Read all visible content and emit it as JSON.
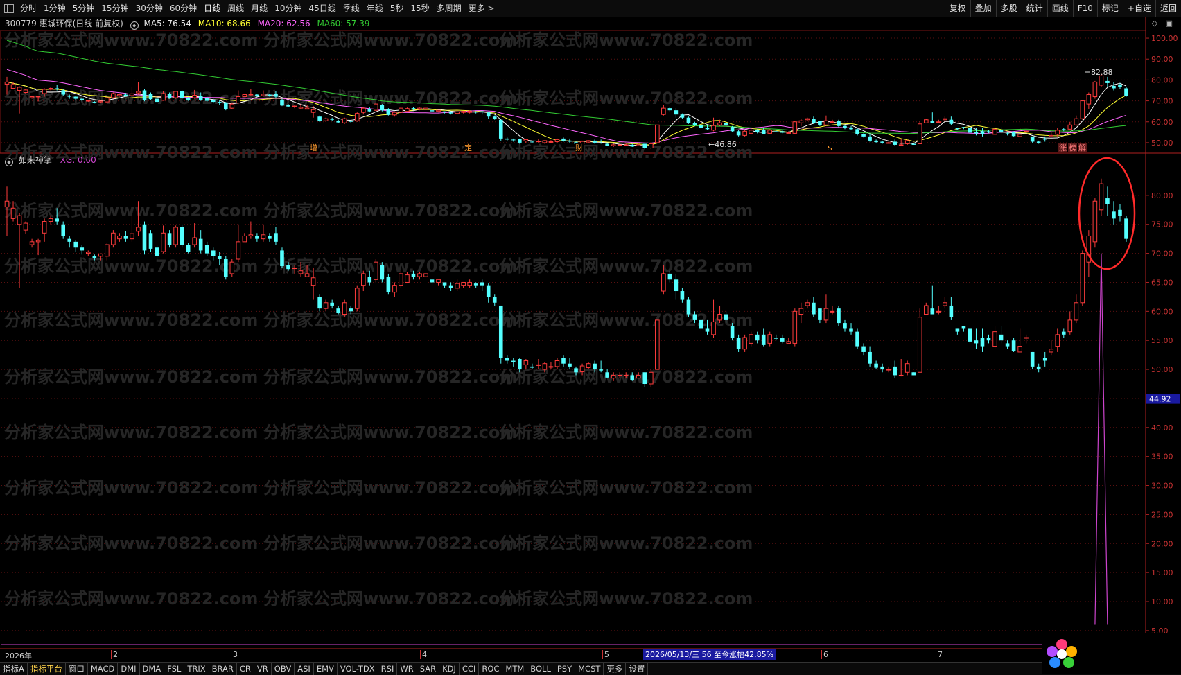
{
  "toolbar": {
    "periods": [
      "分时",
      "1分钟",
      "5分钟",
      "15分钟",
      "30分钟",
      "60分钟",
      "日线",
      "周线",
      "月线",
      "10分钟",
      "45日线",
      "季线",
      "年线",
      "5秒",
      "15秒",
      "多周期",
      "更多 >"
    ],
    "active_period": "日线",
    "right_buttons": [
      "复权",
      "叠加",
      "多股",
      "统计",
      "画线",
      "F10",
      "标记",
      "+自选",
      "返回"
    ]
  },
  "stock": {
    "code_name": "300779 惠城环保(日线 前复权)",
    "ma5": "MA5: 76.54",
    "ma10": "MA10: 68.66",
    "ma20": "MA20: 62.56",
    "ma60": "MA60: 57.39"
  },
  "colors": {
    "up": "#ff3c3c",
    "down": "#54ffff",
    "ma5": "#ffffff",
    "ma10": "#ffff33",
    "ma20": "#ff66ff",
    "ma60": "#33cc33",
    "grid": "#5a1010",
    "axis_text": "#c83232",
    "indicator_line": "#cc44cc",
    "highlight_circle": "#ff2a2a"
  },
  "indicator": {
    "name": "如来神掌",
    "xg": "XG: 0.00"
  },
  "main_axis": [
    "100.00",
    "90.00",
    "80.00",
    "70.00",
    "60.00",
    "50.00"
  ],
  "ind_axis": [
    "80.00",
    "75.00",
    "70.00",
    "65.00",
    "60.00",
    "55.00",
    "50.00",
    "45.00",
    "40.00",
    "35.00",
    "30.00",
    "25.00",
    "20.00",
    "15.00",
    "10.00",
    "5.00"
  ],
  "price_tag": "44.92",
  "annotations": {
    "high": "82.88",
    "low": "46.86",
    "events": [
      "增",
      "定",
      "财",
      "$",
      "涨",
      "榜",
      "解"
    ]
  },
  "watermark": "分析家公式网www.70822.com",
  "date_axis": {
    "year_label": "2026年",
    "months": [
      "2",
      "3",
      "4",
      "5",
      "6",
      "7"
    ],
    "status": "2026/05/13/三  56 至今涨幅42.85%"
  },
  "chart_data": {
    "type": "candlestick",
    "candles": [
      [
        78,
        79,
        73,
        81.5
      ],
      [
        76,
        77.8,
        75.5,
        79
      ],
      [
        75,
        76.5,
        64,
        77
      ],
      [
        74,
        75.2,
        73.4,
        75.5
      ],
      [
        71.5,
        72,
        71,
        72.5
      ],
      [
        72,
        72.2,
        69.7,
        72.5
      ],
      [
        73.5,
        75.5,
        72,
        76
      ],
      [
        75.5,
        76,
        75,
        76.5
      ],
      [
        76,
        75.5,
        75,
        77.8
      ],
      [
        75,
        73,
        72.5,
        75.5
      ],
      [
        72.5,
        72,
        71,
        73
      ],
      [
        72,
        71,
        70.2,
        72.3
      ],
      [
        71,
        70.5,
        69.8,
        71.5
      ],
      [
        70,
        70.2,
        69.5,
        70.5
      ],
      [
        69.5,
        69.2,
        68.8,
        69.8
      ],
      [
        69.5,
        69.9,
        68.8,
        70
      ],
      [
        69.5,
        71.5,
        68.8,
        71.8
      ],
      [
        71.5,
        73.5,
        71,
        74
      ],
      [
        72.5,
        73,
        72,
        73.5
      ],
      [
        73,
        72.5,
        72,
        73.8
      ],
      [
        72.5,
        73.4,
        72,
        76.5
      ],
      [
        73.8,
        74.5,
        73,
        79
      ],
      [
        75,
        70.5,
        69.8,
        75.5
      ],
      [
        73.5,
        70.8,
        70.2,
        74
      ],
      [
        71,
        69.5,
        68.8,
        71.5
      ],
      [
        70.3,
        73.5,
        70,
        74.8
      ],
      [
        73.5,
        71.5,
        71,
        74
      ],
      [
        71.5,
        74.5,
        71,
        74.8
      ],
      [
        74.5,
        71.5,
        71,
        75
      ],
      [
        71.5,
        70.2,
        70,
        71.8
      ],
      [
        71.5,
        72.7,
        71,
        75.2
      ],
      [
        72.5,
        70.5,
        70,
        74
      ],
      [
        71.5,
        70,
        69.5,
        72
      ],
      [
        70.5,
        69.5,
        68.8,
        71
      ],
      [
        69.5,
        69,
        68,
        70.3
      ],
      [
        69,
        66,
        65.5,
        69.5
      ],
      [
        66.5,
        68.5,
        66,
        69
      ],
      [
        69,
        72,
        68.5,
        75
      ],
      [
        72,
        73,
        72.5,
        73.5
      ],
      [
        73,
        73.2,
        72.5,
        75.5
      ],
      [
        73,
        72.5,
        72,
        73.5
      ],
      [
        72.5,
        73.2,
        72,
        75
      ],
      [
        73,
        72.5,
        72,
        73.5
      ],
      [
        73.5,
        72,
        71.5,
        74.5
      ],
      [
        70.5,
        67.8,
        67.5,
        71
      ],
      [
        68,
        67.3,
        67,
        68.5
      ],
      [
        67.5,
        67.5,
        66.5,
        68
      ],
      [
        66.5,
        67,
        66,
        68.5
      ],
      [
        66,
        66.5,
        66,
        68
      ],
      [
        64.5,
        65.8,
        62,
        67.5
      ],
      [
        62.5,
        60.5,
        60,
        63
      ],
      [
        60.5,
        61.5,
        60,
        62
      ],
      [
        61.5,
        61,
        60.5,
        62
      ],
      [
        60.5,
        59.7,
        59.5,
        61
      ],
      [
        59.5,
        61.5,
        59,
        62
      ],
      [
        60.5,
        60,
        59.5,
        61
      ],
      [
        60.5,
        64,
        60,
        64.5
      ],
      [
        64.5,
        66.5,
        63.5,
        67
      ],
      [
        66,
        65,
        64.5,
        67
      ],
      [
        65.5,
        68.5,
        65,
        69
      ],
      [
        68,
        65.5,
        65,
        68.5
      ],
      [
        66,
        63.3,
        63,
        66.5
      ],
      [
        63.3,
        64.5,
        62.5,
        65
      ],
      [
        64.5,
        66.5,
        64,
        67
      ],
      [
        65,
        66.3,
        65.5,
        66.8
      ],
      [
        66.5,
        66,
        65.5,
        67
      ],
      [
        66,
        66.5,
        65.5,
        66.8
      ],
      [
        66,
        66.5,
        65.5,
        67
      ],
      [
        65.5,
        65,
        64.5,
        65.5
      ],
      [
        65,
        65.5,
        64.5,
        65.5
      ],
      [
        65,
        64.5,
        64,
        65
      ],
      [
        64.5,
        64,
        63.5,
        65
      ],
      [
        64,
        64.8,
        63.5,
        65.5
      ],
      [
        64.5,
        65,
        64,
        65
      ],
      [
        64.5,
        65,
        64,
        65.5
      ],
      [
        64.8,
        64.5,
        64,
        65
      ],
      [
        65,
        64.5,
        63.5,
        65.5
      ],
      [
        64.5,
        62.5,
        61.5,
        64.8
      ],
      [
        62.5,
        61.5,
        61,
        63
      ],
      [
        61,
        52,
        51,
        61
      ],
      [
        52,
        51.5,
        51,
        52.5
      ],
      [
        51.5,
        51.3,
        50.5,
        52
      ],
      [
        51.8,
        50,
        49.5,
        52
      ],
      [
        50.8,
        51.5,
        50,
        51.8
      ],
      [
        50.5,
        50.3,
        50,
        51
      ],
      [
        50.8,
        50.8,
        50,
        51.8
      ],
      [
        50,
        51,
        49.5,
        51.2
      ],
      [
        50.5,
        50.5,
        50,
        51.2
      ],
      [
        50.5,
        51.5,
        50,
        52
      ],
      [
        52,
        51,
        50.5,
        52.5
      ],
      [
        51,
        50.5,
        50,
        52
      ],
      [
        50.2,
        49.5,
        49,
        50.5
      ],
      [
        49.6,
        50.6,
        49,
        51
      ],
      [
        50.3,
        51,
        50,
        51.2
      ],
      [
        51,
        50,
        49.5,
        51.5
      ],
      [
        50,
        49.8,
        49.5,
        51.5
      ],
      [
        49.5,
        48.6,
        48.5,
        50
      ],
      [
        48.5,
        49,
        48,
        49.5
      ],
      [
        49,
        49,
        48.5,
        49.5
      ],
      [
        49,
        49,
        48.5,
        49.5
      ],
      [
        49,
        48.2,
        48,
        49.5
      ],
      [
        48.5,
        49,
        48.5,
        49.5
      ],
      [
        49.5,
        47.5,
        47,
        49.5
      ],
      [
        47.5,
        49.5,
        47,
        50
      ],
      [
        50,
        58.5,
        50,
        58.5
      ],
      [
        63.5,
        66.5,
        63,
        68
      ],
      [
        66.5,
        65.5,
        65,
        67
      ],
      [
        65.5,
        63.5,
        62,
        66.5
      ],
      [
        63.5,
        62,
        61.5,
        64
      ],
      [
        62,
        59.5,
        59,
        62.5
      ],
      [
        59.5,
        58.5,
        58,
        60
      ],
      [
        58.5,
        57,
        56.5,
        59
      ],
      [
        57,
        56.5,
        56,
        58.5
      ],
      [
        56,
        58.2,
        55.5,
        62
      ],
      [
        58.5,
        59.5,
        58,
        61
      ],
      [
        59.5,
        58.5,
        58,
        60
      ],
      [
        57.5,
        55.5,
        55,
        58
      ],
      [
        55.5,
        53.5,
        53,
        56
      ],
      [
        53.5,
        55.5,
        53,
        56
      ],
      [
        54.5,
        56,
        54,
        56.5
      ],
      [
        56,
        55,
        54.5,
        56.5
      ],
      [
        56,
        54.2,
        54,
        57
      ],
      [
        54.5,
        56,
        54,
        56.5
      ],
      [
        55.5,
        55.3,
        55,
        56
      ],
      [
        55.5,
        54.8,
        54.5,
        56
      ],
      [
        54.5,
        54.8,
        54.5,
        55.5
      ],
      [
        54.5,
        60,
        54,
        60.5
      ],
      [
        59.5,
        60.5,
        58,
        61.5
      ],
      [
        61,
        61.5,
        60.5,
        62
      ],
      [
        61.5,
        59.5,
        59,
        62.5
      ],
      [
        60.5,
        58.5,
        58,
        60
      ],
      [
        58.5,
        60.5,
        58,
        63
      ],
      [
        60,
        60,
        59.5,
        61
      ],
      [
        60.5,
        58,
        57.5,
        61
      ],
      [
        58,
        57,
        56.5,
        58.5
      ],
      [
        57,
        56.5,
        56,
        58
      ],
      [
        56.5,
        54,
        53.5,
        57
      ],
      [
        54,
        53,
        52.5,
        54.5
      ],
      [
        53,
        51,
        50.5,
        54
      ],
      [
        51,
        50.3,
        50,
        51.5
      ],
      [
        50.5,
        50,
        49.5,
        51
      ],
      [
        50,
        50,
        49.5,
        50.5
      ],
      [
        50.5,
        49,
        48.5,
        51.5
      ],
      [
        49,
        49,
        48.8,
        51.8
      ],
      [
        49.5,
        51,
        49,
        51.5
      ],
      [
        49.5,
        49,
        49,
        49.5
      ],
      [
        49.5,
        59,
        49.5,
        60.5
      ],
      [
        59.5,
        61,
        60.5,
        61.5
      ],
      [
        60.5,
        59.5,
        59.5,
        64.5
      ],
      [
        60,
        60,
        59.5,
        61
      ],
      [
        61,
        61.5,
        60.5,
        62.5
      ],
      [
        61,
        59,
        58.5,
        62.5
      ],
      [
        57,
        56.5,
        56,
        57
      ],
      [
        57.5,
        57,
        56.5,
        57.5
      ],
      [
        57,
        54.8,
        54.5,
        57
      ],
      [
        55,
        54.5,
        53.5,
        57
      ],
      [
        55.5,
        54,
        53,
        57
      ],
      [
        55.5,
        55,
        54.5,
        56
      ],
      [
        54,
        56.5,
        53.5,
        57.5
      ],
      [
        56,
        55,
        54.5,
        57.5
      ],
      [
        54.5,
        54,
        53.5,
        55
      ],
      [
        55,
        53.2,
        53,
        55.5
      ],
      [
        53,
        54,
        53,
        57
      ],
      [
        55.5,
        55.5,
        54.5,
        56
      ],
      [
        53,
        50.5,
        50,
        53
      ],
      [
        50.5,
        50,
        49.5,
        51
      ],
      [
        52,
        51.5,
        50.5,
        53
      ],
      [
        53,
        53.5,
        52.5,
        55
      ],
      [
        54,
        56,
        53,
        57
      ],
      [
        56.5,
        56,
        55.5,
        57
      ],
      [
        56.5,
        58.5,
        56,
        60
      ],
      [
        58.5,
        61.5,
        58,
        63
      ],
      [
        61.5,
        70,
        61,
        70.5
      ],
      [
        68.5,
        73,
        66,
        74
      ],
      [
        72,
        79,
        71,
        79.5
      ],
      [
        77.5,
        82,
        76.5,
        82.88
      ],
      [
        79.5,
        78.5,
        76.5,
        81.5
      ],
      [
        77.2,
        76,
        75,
        79
      ],
      [
        77.5,
        76.5,
        75.5,
        78.5
      ],
      [
        76,
        72.5,
        72,
        76.5
      ]
    ],
    "y_range_main": [
      46,
      103
    ],
    "y_range_indicator": [
      2,
      85
    ],
    "indicator_spike_price": 6
  }
}
